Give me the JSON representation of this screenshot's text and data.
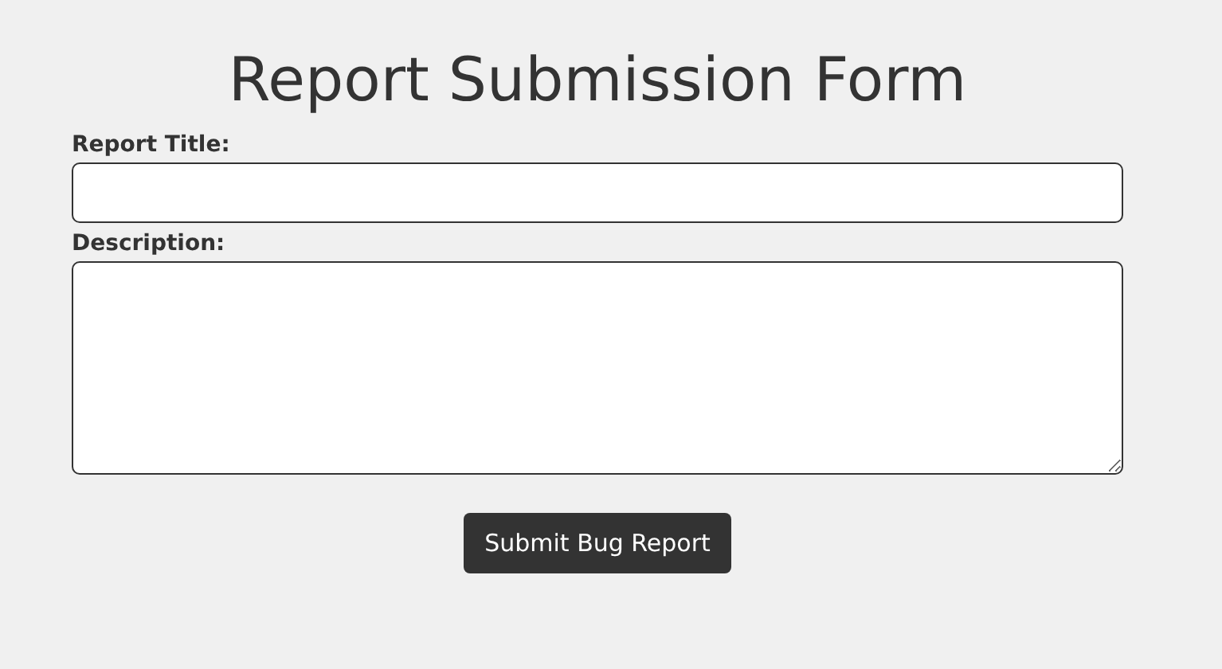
{
  "title": "Report Submission Form",
  "fields": [
    {
      "kind": "input",
      "label": "Report Title:"
    },
    {
      "kind": "textarea",
      "label": "Description:"
    }
  ],
  "submit_button": "Submit Bug Report"
}
